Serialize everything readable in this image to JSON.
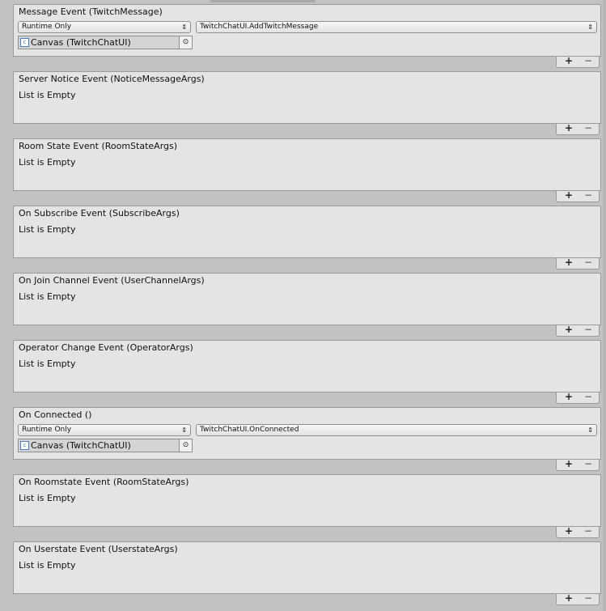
{
  "events": [
    {
      "title": "Message Event (TwitchMessage)",
      "listener": {
        "mode": "Runtime Only",
        "function": "TwitchChatUI.AddTwitchMessage",
        "target": "Canvas (TwitchChatUI)"
      }
    },
    {
      "title": "Server Notice Event (NoticeMessageArgs)",
      "empty": "List is Empty"
    },
    {
      "title": "Room State Event (RoomStateArgs)",
      "empty": "List is Empty"
    },
    {
      "title": "On Subscribe Event (SubscribeArgs)",
      "empty": "List is Empty"
    },
    {
      "title": "On Join Channel Event (UserChannelArgs)",
      "empty": "List is Empty"
    },
    {
      "title": "Operator Change Event (OperatorArgs)",
      "empty": "List is Empty"
    },
    {
      "title": "On Connected ()",
      "listener": {
        "mode": "Runtime Only",
        "function": "TwitchChatUI.OnConnected",
        "target": "Canvas (TwitchChatUI)"
      }
    },
    {
      "title": "On Roomstate Event (RoomStateArgs)",
      "empty": "List is Empty"
    },
    {
      "title": "On Userstate Event (UserstateArgs)",
      "empty": "List is Empty"
    }
  ],
  "footer": {
    "add_label": "+",
    "remove_label": "−"
  },
  "icons": {
    "dropdown_arrow": "updown-arrows-icon",
    "object_picker": "target-circle-icon",
    "object_type": "script-object-icon"
  }
}
